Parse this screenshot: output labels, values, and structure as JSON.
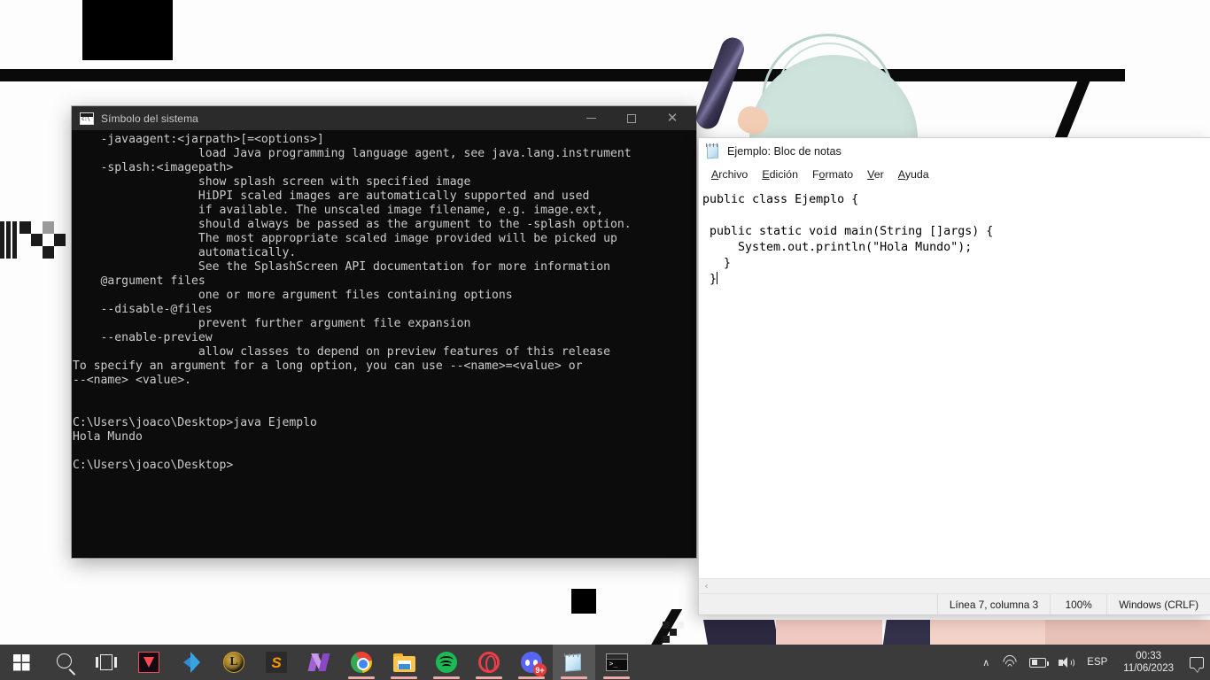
{
  "desktop": {
    "wallpaper_description": "white background with black geometric bars and anime character artwork"
  },
  "cmd_window": {
    "title": "Símbolo del sistema",
    "icon": "cmd-icon",
    "controls": {
      "minimize": "—",
      "maximize": "☐",
      "close": "✕"
    },
    "console_text": "    -javaagent:<jarpath>[=<options>]\n                  load Java programming language agent, see java.lang.instrument\n    -splash:<imagepath>\n                  show splash screen with specified image\n                  HiDPI scaled images are automatically supported and used\n                  if available. The unscaled image filename, e.g. image.ext,\n                  should always be passed as the argument to the -splash option.\n                  The most appropriate scaled image provided will be picked up\n                  automatically.\n                  See the SplashScreen API documentation for more information\n    @argument files\n                  one or more argument files containing options\n    --disable-@files\n                  prevent further argument file expansion\n    --enable-preview\n                  allow classes to depend on preview features of this release\nTo specify an argument for a long option, you can use --<name>=<value> or\n--<name> <value>.\n\n\nC:\\Users\\joaco\\Desktop>java Ejemplo\nHola Mundo\n\nC:\\Users\\joaco\\Desktop>"
  },
  "notepad_window": {
    "title": "Ejemplo: Bloc de notas",
    "icon": "notepad-icon",
    "menu": [
      {
        "label": "Archivo",
        "mnemonic": "A",
        "rest": "rchivo"
      },
      {
        "label": "Edición",
        "mnemonic": "E",
        "rest": "dición"
      },
      {
        "label": "Formato",
        "pre": "F",
        "mnemonic": "o",
        "rest": "rmato"
      },
      {
        "label": "Ver",
        "mnemonic": "V",
        "rest": "er"
      },
      {
        "label": "Ayuda",
        "mnemonic": "A",
        "rest": "yuda"
      }
    ],
    "editor_text": "public class Ejemplo {\n\n public static void main(String []args) {\n     System.out.println(\"Hola Mundo\");\n   }\n }",
    "hscroll_arrow": "‹",
    "status": {
      "cursor": "Línea 7, columna 3",
      "zoom": "100%",
      "encoding_eol": "Windows (CRLF)"
    }
  },
  "taskbar": {
    "items": [
      {
        "name": "start-button",
        "icon": "windows-logo-icon",
        "running": false,
        "active": false
      },
      {
        "name": "search-button",
        "icon": "search-icon",
        "running": false,
        "active": false
      },
      {
        "name": "task-view-button",
        "icon": "task-view-icon",
        "running": false,
        "active": false
      },
      {
        "name": "valorant",
        "icon": "valorant-icon",
        "running": false,
        "active": false
      },
      {
        "name": "visual-studio-code",
        "icon": "vscode-icon",
        "running": false,
        "active": false
      },
      {
        "name": "league-of-legends",
        "icon": "league-icon",
        "running": false,
        "active": false
      },
      {
        "name": "sublime-text",
        "icon": "sublime-icon",
        "running": false,
        "active": false
      },
      {
        "name": "nvidia",
        "icon": "nvidia-icon",
        "running": false,
        "active": false
      },
      {
        "name": "google-chrome",
        "icon": "chrome-icon",
        "running": true,
        "active": false
      },
      {
        "name": "file-explorer",
        "icon": "folder-icon",
        "running": true,
        "active": false
      },
      {
        "name": "spotify",
        "icon": "spotify-icon",
        "running": true,
        "active": false
      },
      {
        "name": "opera-gx",
        "icon": "opera-icon",
        "running": true,
        "active": false
      },
      {
        "name": "discord",
        "icon": "discord-icon",
        "running": true,
        "active": false,
        "badge": "9+"
      },
      {
        "name": "notepad",
        "icon": "notepad-icon",
        "running": true,
        "active": true
      },
      {
        "name": "command-prompt",
        "icon": "cmd-icon",
        "running": true,
        "active": false
      }
    ],
    "tray": {
      "chevron": "∧",
      "language": "ESP",
      "time": "00:33",
      "date": "11/06/2023"
    }
  },
  "colors": {
    "taskbar_bg": "#3b3b3b",
    "cmd_bg": "#0c0c0c",
    "cmd_titlebar": "#2b2b2b",
    "cmd_text": "#cccccc",
    "notepad_bg": "#ffffff",
    "status_bg": "#f0f0f0",
    "running_indicator": "#f0a8a8",
    "accent_discord_badge": "#e23b3b"
  }
}
